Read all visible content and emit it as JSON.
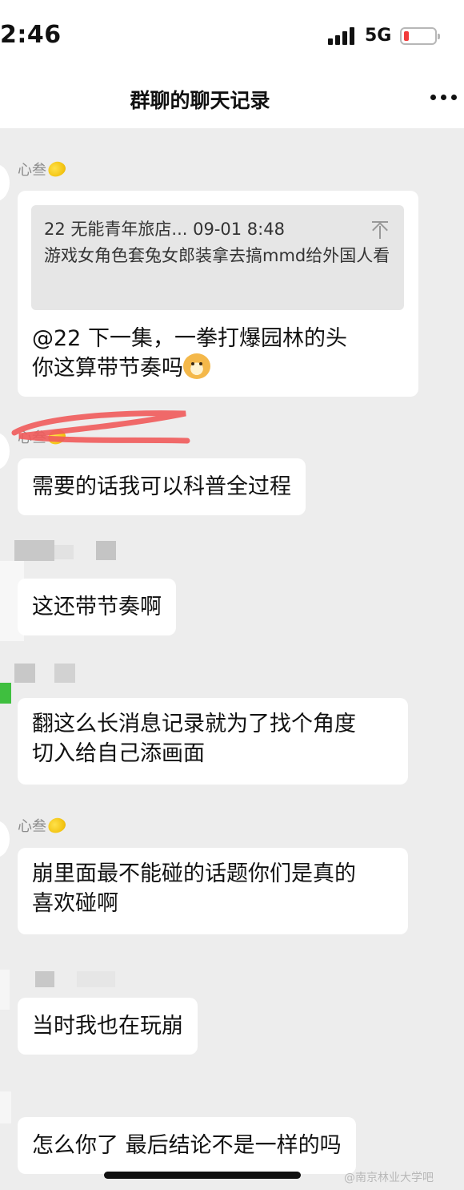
{
  "status_bar": {
    "time": "2:46",
    "network": "5G",
    "battery_level": 0.15
  },
  "header": {
    "title": "群聊的聊天记录"
  },
  "messages": [
    {
      "sender": "心叁",
      "quote": {
        "header": "22 无能青年旅店... 09-01 8:48",
        "text": "游戏女角色套兔女郎装拿去搞mmd给外国人看"
      },
      "lines": [
        "@22 下一集，一拳打爆园林的头",
        "你这算带节奏吗"
      ]
    },
    {
      "sender": "心叁",
      "lines": [
        "需要的话我可以科普全过程"
      ]
    },
    {
      "lines": [
        "这还带节奏啊"
      ]
    },
    {
      "lines": [
        "翻这么长消息记录就为了找个角度",
        "切入给自己添画面"
      ]
    },
    {
      "sender": "心叁",
      "lines": [
        "崩里面最不能碰的话题你们是真的",
        "喜欢碰啊"
      ]
    },
    {
      "lines": [
        "当时我也在玩崩"
      ]
    },
    {
      "lines": [
        "怎么你了 最后结论不是一样的吗"
      ]
    }
  ],
  "watermark": "@南京林业大学吧",
  "colors": {
    "background": "#ededed",
    "bubble": "#ffffff",
    "quote_card": "#e6e6e6",
    "annotation_red": "#f05a5a",
    "battery_red": "#f23b3b"
  }
}
